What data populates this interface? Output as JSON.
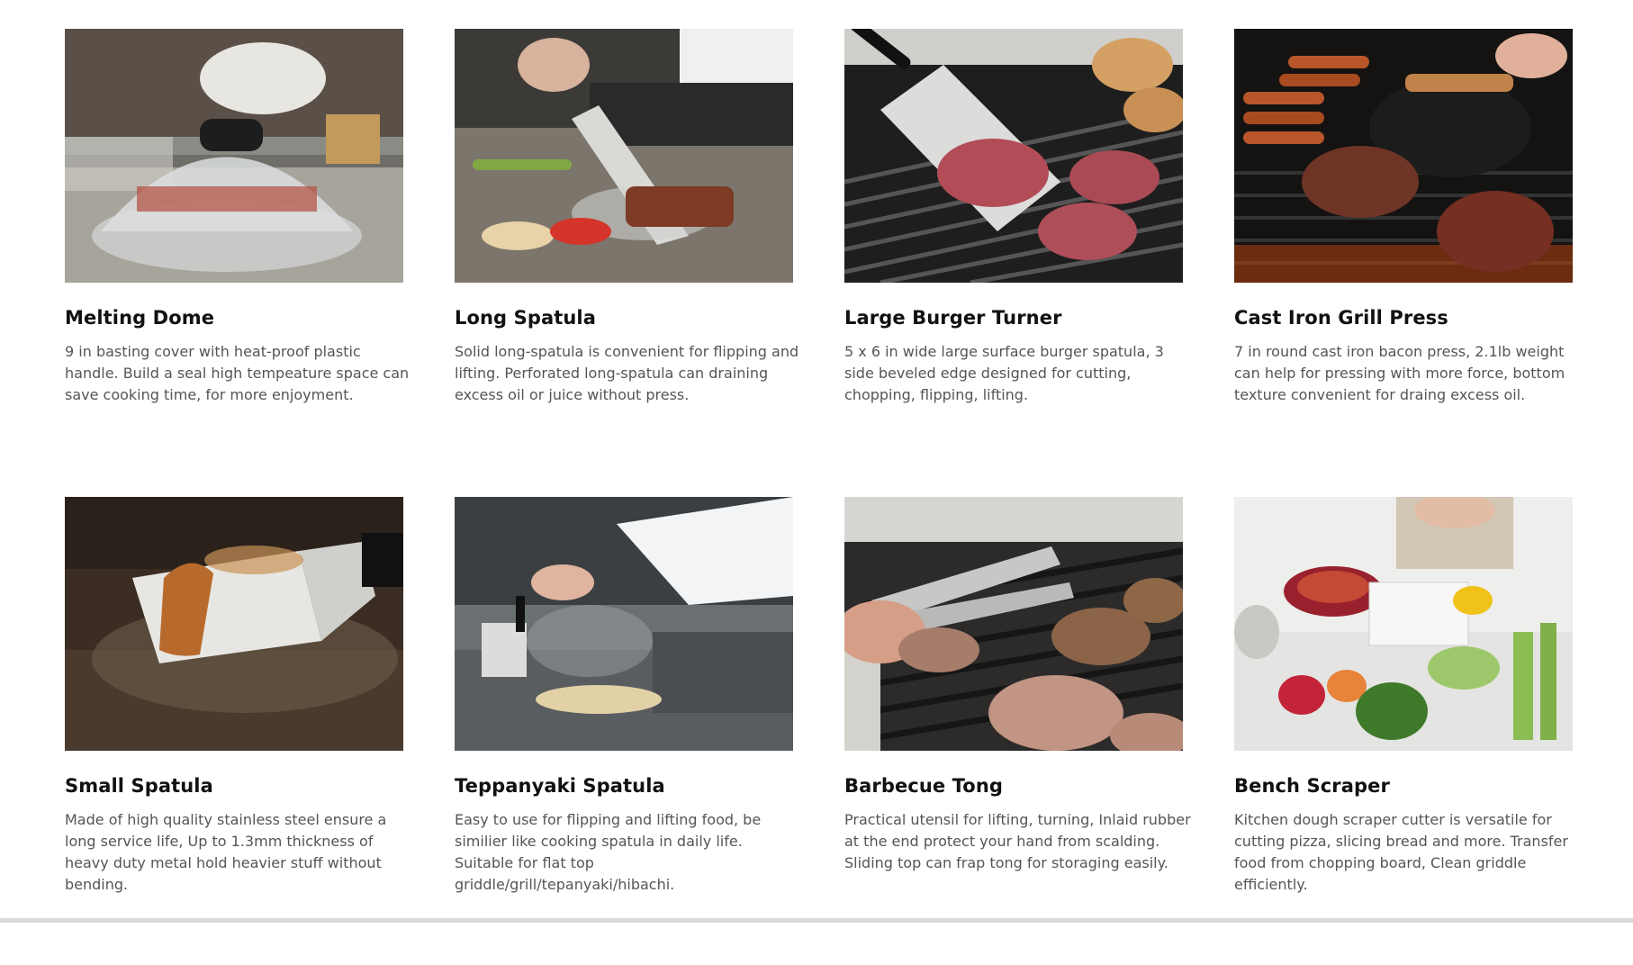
{
  "products": [
    {
      "title": "Melting Dome",
      "description": "9 in basting cover with heat-proof plastic handle. Build a seal high tempeature space can save cooking time, for more enjoyment.",
      "image_subject": "melting-dome-photo"
    },
    {
      "title": "Long Spatula",
      "description": "Solid long-spatula is convenient for flipping and lifting. Perforated long-spatula can draining excess oil or juice without press.",
      "image_subject": "long-spatula-photo"
    },
    {
      "title": "Large Burger Turner",
      "description": "5 x 6 in wide large surface burger spatula, 3 side beveled edge designed for cutting, chopping, flipping, lifting.",
      "image_subject": "burger-turner-photo"
    },
    {
      "title": "Cast Iron Grill Press",
      "description": "7 in round cast iron bacon press, 2.1lb weight can help for pressing with more force, bottom texture convenient for draing excess oil.",
      "image_subject": "grill-press-photo"
    },
    {
      "title": "Small Spatula",
      "description": "Made of high quality stainless steel ensure a long service life, Up to 1.3mm thickness of heavy duty metal hold heavier stuff without bending.",
      "image_subject": "small-spatula-photo"
    },
    {
      "title": "Teppanyaki Spatula",
      "description": "Easy to use for flipping and lifting food, be similier like cooking spatula in daily life. Suitable for flat top griddle/grill/tepanyaki/hibachi.",
      "image_subject": "teppanyaki-spatula-photo"
    },
    {
      "title": "Barbecue Tong",
      "description": "Practical utensil for lifting, turning, Inlaid rubber at the end protect your hand from scalding. Sliding top can frap tong for storaging easily.",
      "image_subject": "barbecue-tong-photo"
    },
    {
      "title": "Bench Scraper",
      "description": "Kitchen dough scraper cutter is versatile for cutting pizza, slicing bread and more. Transfer food from chopping board, Clean griddle efficiently.",
      "image_subject": "bench-scraper-photo"
    }
  ]
}
